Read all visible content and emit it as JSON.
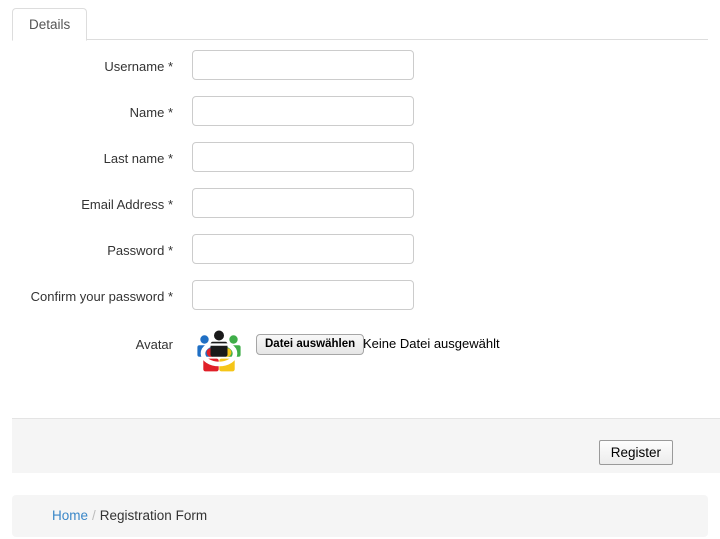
{
  "tabs": [
    {
      "label": "Details",
      "active": true
    }
  ],
  "form": {
    "fields": [
      {
        "label": "Username",
        "required_marker": "*",
        "type": "text",
        "value": "",
        "placeholder": ""
      },
      {
        "label": "Name",
        "required_marker": "*",
        "type": "text",
        "value": "",
        "placeholder": ""
      },
      {
        "label": "Last name",
        "required_marker": "*",
        "type": "text",
        "value": "",
        "placeholder": ""
      },
      {
        "label": "Email Address",
        "required_marker": "*",
        "type": "text",
        "value": "",
        "placeholder": ""
      },
      {
        "label": "Password",
        "required_marker": "*",
        "type": "password",
        "value": "",
        "placeholder": ""
      },
      {
        "label": "Confirm your password",
        "required_marker": "*",
        "type": "password",
        "value": "",
        "placeholder": ""
      }
    ],
    "avatar": {
      "label": "Avatar",
      "icon": "people-circle-avatar-icon",
      "file_button_label": "Datei auswählen",
      "file_status_text": "Keine Datei ausgewählt"
    }
  },
  "actions": {
    "register_label": "Register"
  },
  "breadcrumb": {
    "home_label": "Home",
    "separator": "/",
    "current_label": "Registration Form"
  },
  "colors": {
    "link": "#3a87c8",
    "panel_background": "#f5f5f5",
    "input_border": "#cccccc",
    "tab_border": "#dddddd",
    "text": "#333333",
    "avatar_blue": "#1f6fc4",
    "avatar_green": "#3fae49",
    "avatar_red": "#e02028",
    "avatar_yellow": "#f5c518",
    "avatar_black": "#1a1a1a"
  }
}
